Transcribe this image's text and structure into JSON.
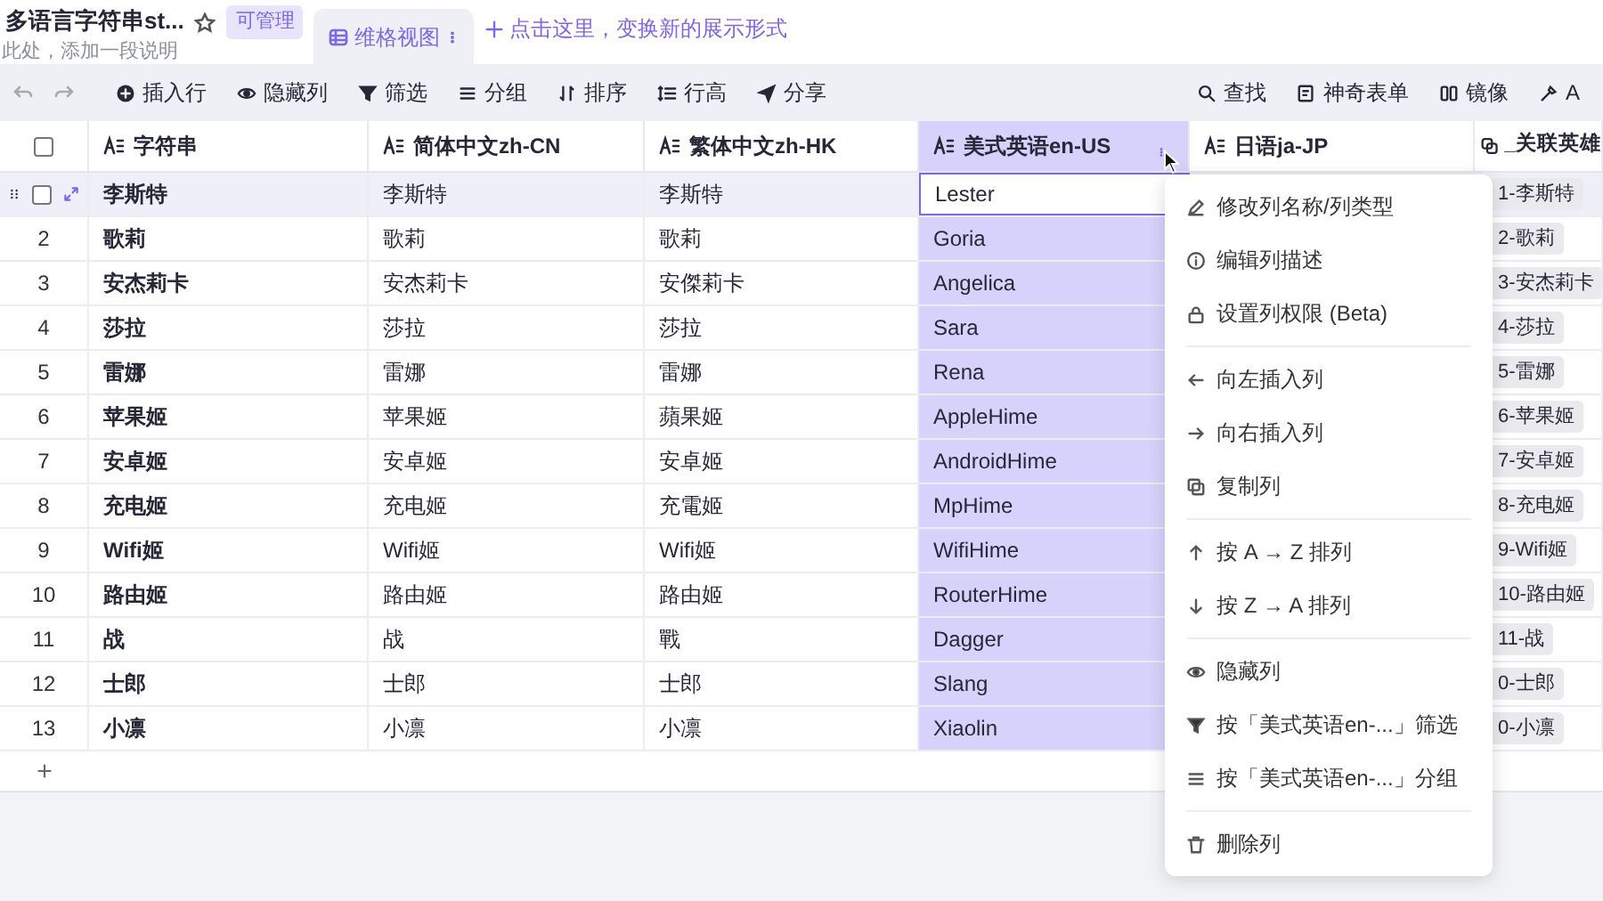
{
  "sheet": {
    "title": "多语言字符串st...",
    "starred": false,
    "permission_badge": "可管理",
    "description": "此处，添加一段说明"
  },
  "views": [
    {
      "label": "维格视图",
      "selected": true
    }
  ],
  "add_view": "点击这里，变换新的展示形式",
  "toolbar": {
    "left": [
      "插入行",
      "隐藏列",
      "筛选",
      "分组",
      "排序",
      "行高",
      "分享"
    ],
    "right": [
      "查找",
      "神奇表单",
      "镜像",
      "A"
    ]
  },
  "select_all": {
    "checked": false
  },
  "columns": [
    {
      "label": "字符串",
      "kind": "text",
      "selected": false
    },
    {
      "label": "简体中文zh-CN",
      "kind": "text",
      "selected": false
    },
    {
      "label": "繁体中文zh-HK",
      "kind": "text",
      "selected": false
    },
    {
      "label": "美式英语en-US",
      "kind": "text",
      "selected": true
    },
    {
      "label": "日语ja-JP",
      "kind": "text",
      "selected": false
    },
    {
      "label": "_关联英雄",
      "kind": "link",
      "selected": false
    }
  ],
  "rows": [
    {
      "selected": true,
      "checked": false,
      "editing": true,
      "cells": [
        "李斯特",
        "李斯特",
        "李斯特",
        "Lester",
        "1-李斯特"
      ]
    },
    {
      "number": "2",
      "selected": false,
      "cells": [
        "歌莉",
        "歌莉",
        "歌莉",
        "Goria",
        "2-歌莉"
      ]
    },
    {
      "number": "3",
      "selected": false,
      "cells": [
        "安杰莉卡",
        "安杰莉卡",
        "安傑莉卡",
        "Angelica",
        "3-安杰莉卡"
      ]
    },
    {
      "number": "4",
      "selected": false,
      "cells": [
        "莎拉",
        "莎拉",
        "莎拉",
        "Sara",
        "4-莎拉"
      ]
    },
    {
      "number": "5",
      "selected": false,
      "cells": [
        "雷娜",
        "雷娜",
        "雷娜",
        "Rena",
        "5-雷娜"
      ]
    },
    {
      "number": "6",
      "selected": false,
      "cells": [
        "苹果姬",
        "苹果姬",
        "蘋果姬",
        "AppleHime",
        "6-苹果姬"
      ]
    },
    {
      "number": "7",
      "selected": false,
      "cells": [
        "安卓姬",
        "安卓姬",
        "安卓姬",
        "AndroidHime",
        "7-安卓姬"
      ]
    },
    {
      "number": "8",
      "selected": false,
      "cells": [
        "充电姬",
        "充电姬",
        "充電姬",
        "MpHime",
        "8-充电姬"
      ]
    },
    {
      "number": "9",
      "selected": false,
      "cells": [
        "Wifi姬",
        "Wifi姬",
        "Wifi姬",
        "WifiHime",
        "9-Wifi姬"
      ]
    },
    {
      "number": "10",
      "selected": false,
      "cells": [
        "路由姬",
        "路由姬",
        "路由姬",
        "RouterHime",
        "10-路由姬"
      ]
    },
    {
      "number": "11",
      "selected": false,
      "cells": [
        "战",
        "战",
        "戰",
        "Dagger",
        "11-战"
      ]
    },
    {
      "number": "12",
      "selected": false,
      "cells": [
        "士郎",
        "士郎",
        "士郎",
        "Slang",
        "0-士郎"
      ]
    },
    {
      "number": "13",
      "selected": false,
      "cells": [
        "小凛",
        "小凛",
        "小凛",
        "Xiaolin",
        "0-小凛"
      ]
    }
  ],
  "add_row": "+",
  "column_menu": [
    [
      "修改列名称/列类型",
      "编辑列描述",
      "设置列权限 (Beta)"
    ],
    [
      "向左插入列",
      "向右插入列",
      "复制列"
    ],
    [
      "按 A → Z 排列",
      "按 Z → A 排列"
    ],
    [
      "隐藏列",
      "按「美式英语en-...」筛选",
      "按「美式英语en-...」分组"
    ],
    [
      "删除列"
    ]
  ]
}
